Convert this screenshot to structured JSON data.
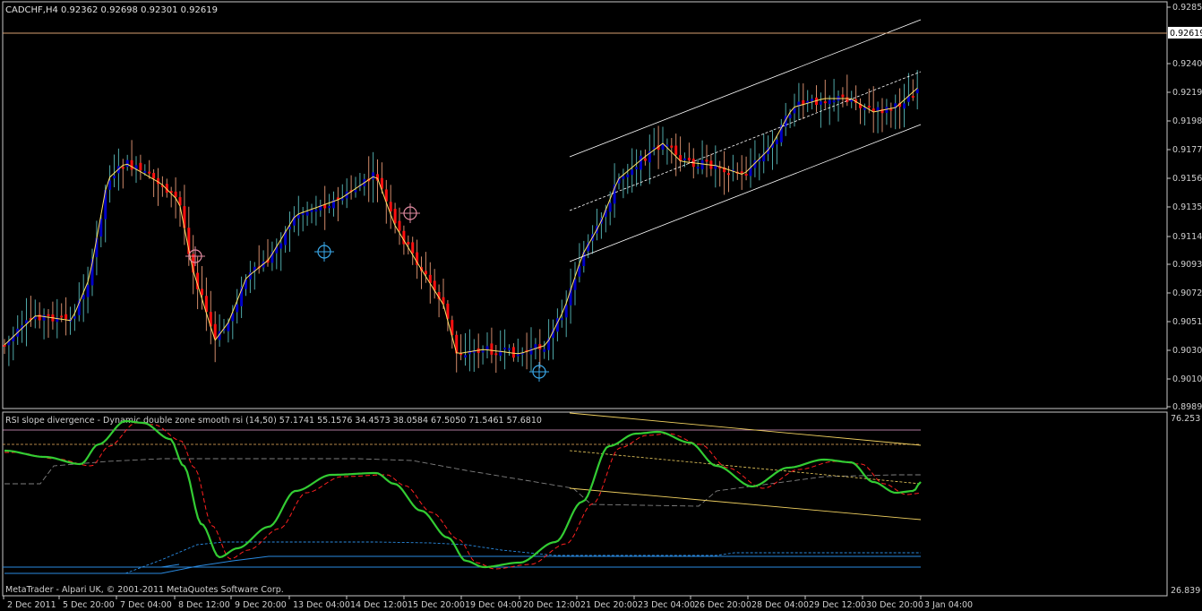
{
  "window": {
    "symbol_header": "CADCHF,H4  0.92362 0.92698 0.92301 0.92619",
    "indicator_header": "RSI slope divergence -  Dynamic double zone smooth rsi (14,50) 57.1741 55.1576 34.4573 38.0584 67.5050 71.5461 57.6810",
    "copyright": "MetaTrader - Alpari UK, © 2001-2011 MetaQuotes Software Corp.",
    "current_price": "0.92619",
    "indicator_scale_top": "76.253",
    "indicator_scale_bottom": "26.839"
  },
  "colors": {
    "background": "#000000",
    "axis": "#c8c8c8",
    "bull": "#0000c8",
    "bear": "#ff1010",
    "wick_bull": "#4fa8a8",
    "wick_bear": "#d08a6a",
    "ma": "#ffe066",
    "channel": "#ffffff",
    "price_line": "#d9a070",
    "rsi_green": "#33cc33",
    "rsi_red": "#ff2020",
    "rsi_gray": "#808080",
    "zone_blue": "#2a8ae0",
    "zone_orange": "#f0b060",
    "zone_pink": "#e6a0d0",
    "marker_blue": "#3aa8e8",
    "marker_pink": "#e08aa0"
  },
  "price_axis": {
    "labels": [
      "0.92850",
      "0.92400",
      "0.92190",
      "0.91980",
      "0.91770",
      "0.91560",
      "0.91355",
      "0.91145",
      "0.90935",
      "0.90725",
      "0.90515",
      "0.90305",
      "0.90100",
      "0.89890"
    ]
  },
  "time_axis": {
    "labels": [
      "2 Dec 2011",
      "5 Dec 20:00",
      "7 Dec 04:00",
      "8 Dec 12:00",
      "9 Dec 20:00",
      "13 Dec 04:00",
      "14 Dec 12:00",
      "15 Dec 20:00",
      "19 Dec 04:00",
      "20 Dec 12:00",
      "21 Dec 20:00",
      "23 Dec 04:00",
      "26 Dec 20:00",
      "28 Dec 04:00",
      "29 Dec 12:00",
      "30 Dec 20:00",
      "3 Jan 04:00"
    ]
  },
  "icons": {
    "markers": [
      "crosshair-target-icon",
      "crosshair-target-icon",
      "crosshair-target-icon",
      "crosshair-target-icon"
    ]
  }
}
